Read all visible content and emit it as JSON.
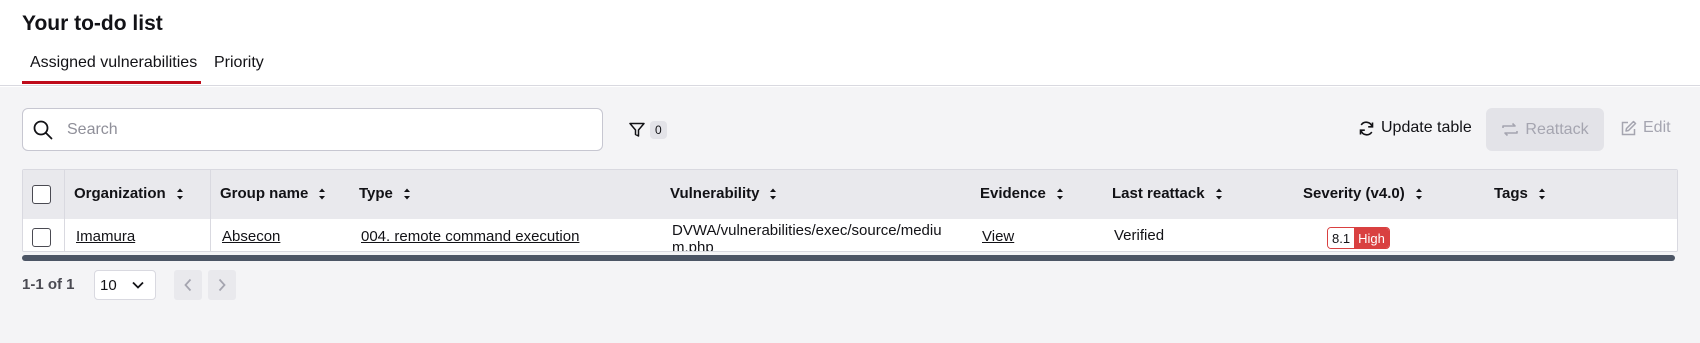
{
  "page": {
    "title": "Your to-do list"
  },
  "tabs": [
    {
      "label": "Assigned vulnerabilities",
      "active": true
    },
    {
      "label": "Priority",
      "active": false
    }
  ],
  "toolbar": {
    "search_placeholder": "Search",
    "search_value": "",
    "filter_count": "0",
    "update_label": "Update table",
    "reattack_label": "Reattack",
    "edit_label": "Edit"
  },
  "table": {
    "columns": [
      "Organization",
      "Group name",
      "Type",
      "Vulnerability",
      "Evidence",
      "Last reattack",
      "Severity (v4.0)",
      "Tags"
    ],
    "rows": [
      {
        "organization": "Imamura",
        "group": "Absecon",
        "type": "004. remote command execution",
        "vulnerability": "DVWA/vulnerabilities/exec/source/medium.php",
        "evidence": "View",
        "last_reattack": "Verified",
        "severity_score": "8.1",
        "severity_label": "High",
        "tags": ""
      }
    ]
  },
  "pagination": {
    "summary": "1-1 of 1",
    "page_size": "10"
  },
  "colors": {
    "accent": "#bf0b1a",
    "severity_high": "#d94040",
    "scrollbar": "#4c5565"
  }
}
